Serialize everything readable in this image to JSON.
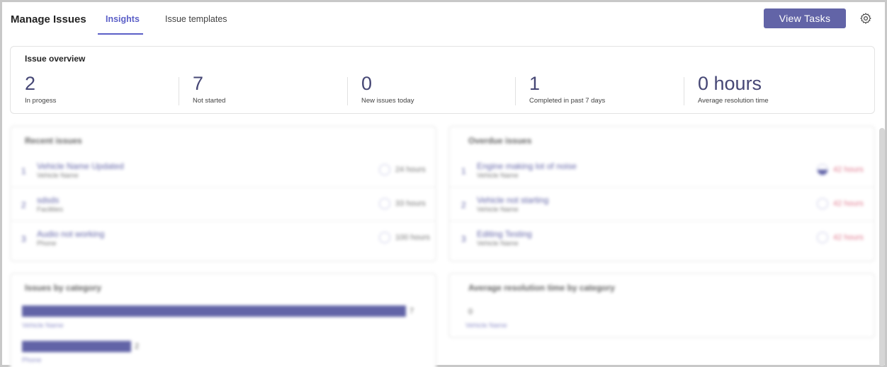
{
  "header": {
    "title": "Manage Issues",
    "tabs": [
      {
        "label": "Insights",
        "active": true
      },
      {
        "label": "Issue templates",
        "active": false
      }
    ],
    "primary_button": "View Tasks",
    "settings_icon": "gear-icon"
  },
  "overview": {
    "title": "Issue overview",
    "metrics": [
      {
        "value": "2",
        "label": "In progess"
      },
      {
        "value": "7",
        "label": "Not started"
      },
      {
        "value": "0",
        "label": "New issues today"
      },
      {
        "value": "1",
        "label": "Completed in past 7 days"
      },
      {
        "value": "0 hours",
        "label": "Average resolution time"
      }
    ]
  },
  "recent": {
    "title": "Recent issues",
    "rows": [
      {
        "idx": "1",
        "name": "Vehicle Name Updated",
        "sub": "Vehicle Name",
        "hours": "24 hours"
      },
      {
        "idx": "2",
        "name": "sdsds",
        "sub": "Facilities",
        "hours": "33 hours"
      },
      {
        "idx": "3",
        "name": "Audio not working",
        "sub": "Phone",
        "hours": "100 hours"
      }
    ]
  },
  "overdue": {
    "title": "Overdue issues",
    "rows": [
      {
        "idx": "1",
        "name": "Engine making lot of noise",
        "sub": "Vehicle Name",
        "hours": "42 hours"
      },
      {
        "idx": "2",
        "name": "Vehicle not starting",
        "sub": "Vehicle Name",
        "hours": "42 hours"
      },
      {
        "idx": "3",
        "name": "Editing Testing",
        "sub": "Vehicle Name",
        "hours": "42 hours"
      }
    ]
  },
  "by_category": {
    "title": "Issues by category",
    "bars": [
      {
        "value": "7",
        "label": "Vehicle Name",
        "fraction": 1.0
      },
      {
        "value": "2",
        "label": "Phone",
        "fraction": 0.285
      }
    ]
  },
  "avg_resolution": {
    "title": "Average resolution time by category",
    "value": "0",
    "label": "Vehicle Name"
  },
  "colors": {
    "accent": "#6264a7",
    "accent_text": "#5b5fc7",
    "overdue": "#e07a8f"
  }
}
